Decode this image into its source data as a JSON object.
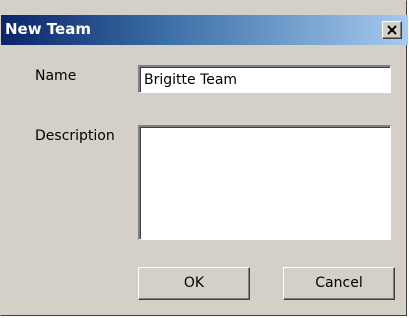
{
  "dialog": {
    "title": "New Team",
    "close_glyph": "close-icon"
  },
  "form": {
    "name_label": "Name",
    "name_value": "Brigitte Team",
    "description_label": "Description",
    "description_value": ""
  },
  "buttons": {
    "ok_label": "OK",
    "cancel_label": "Cancel"
  },
  "colors": {
    "face": "#d4d0c8",
    "title_start": "#0a246a",
    "title_end": "#a6caf0"
  }
}
